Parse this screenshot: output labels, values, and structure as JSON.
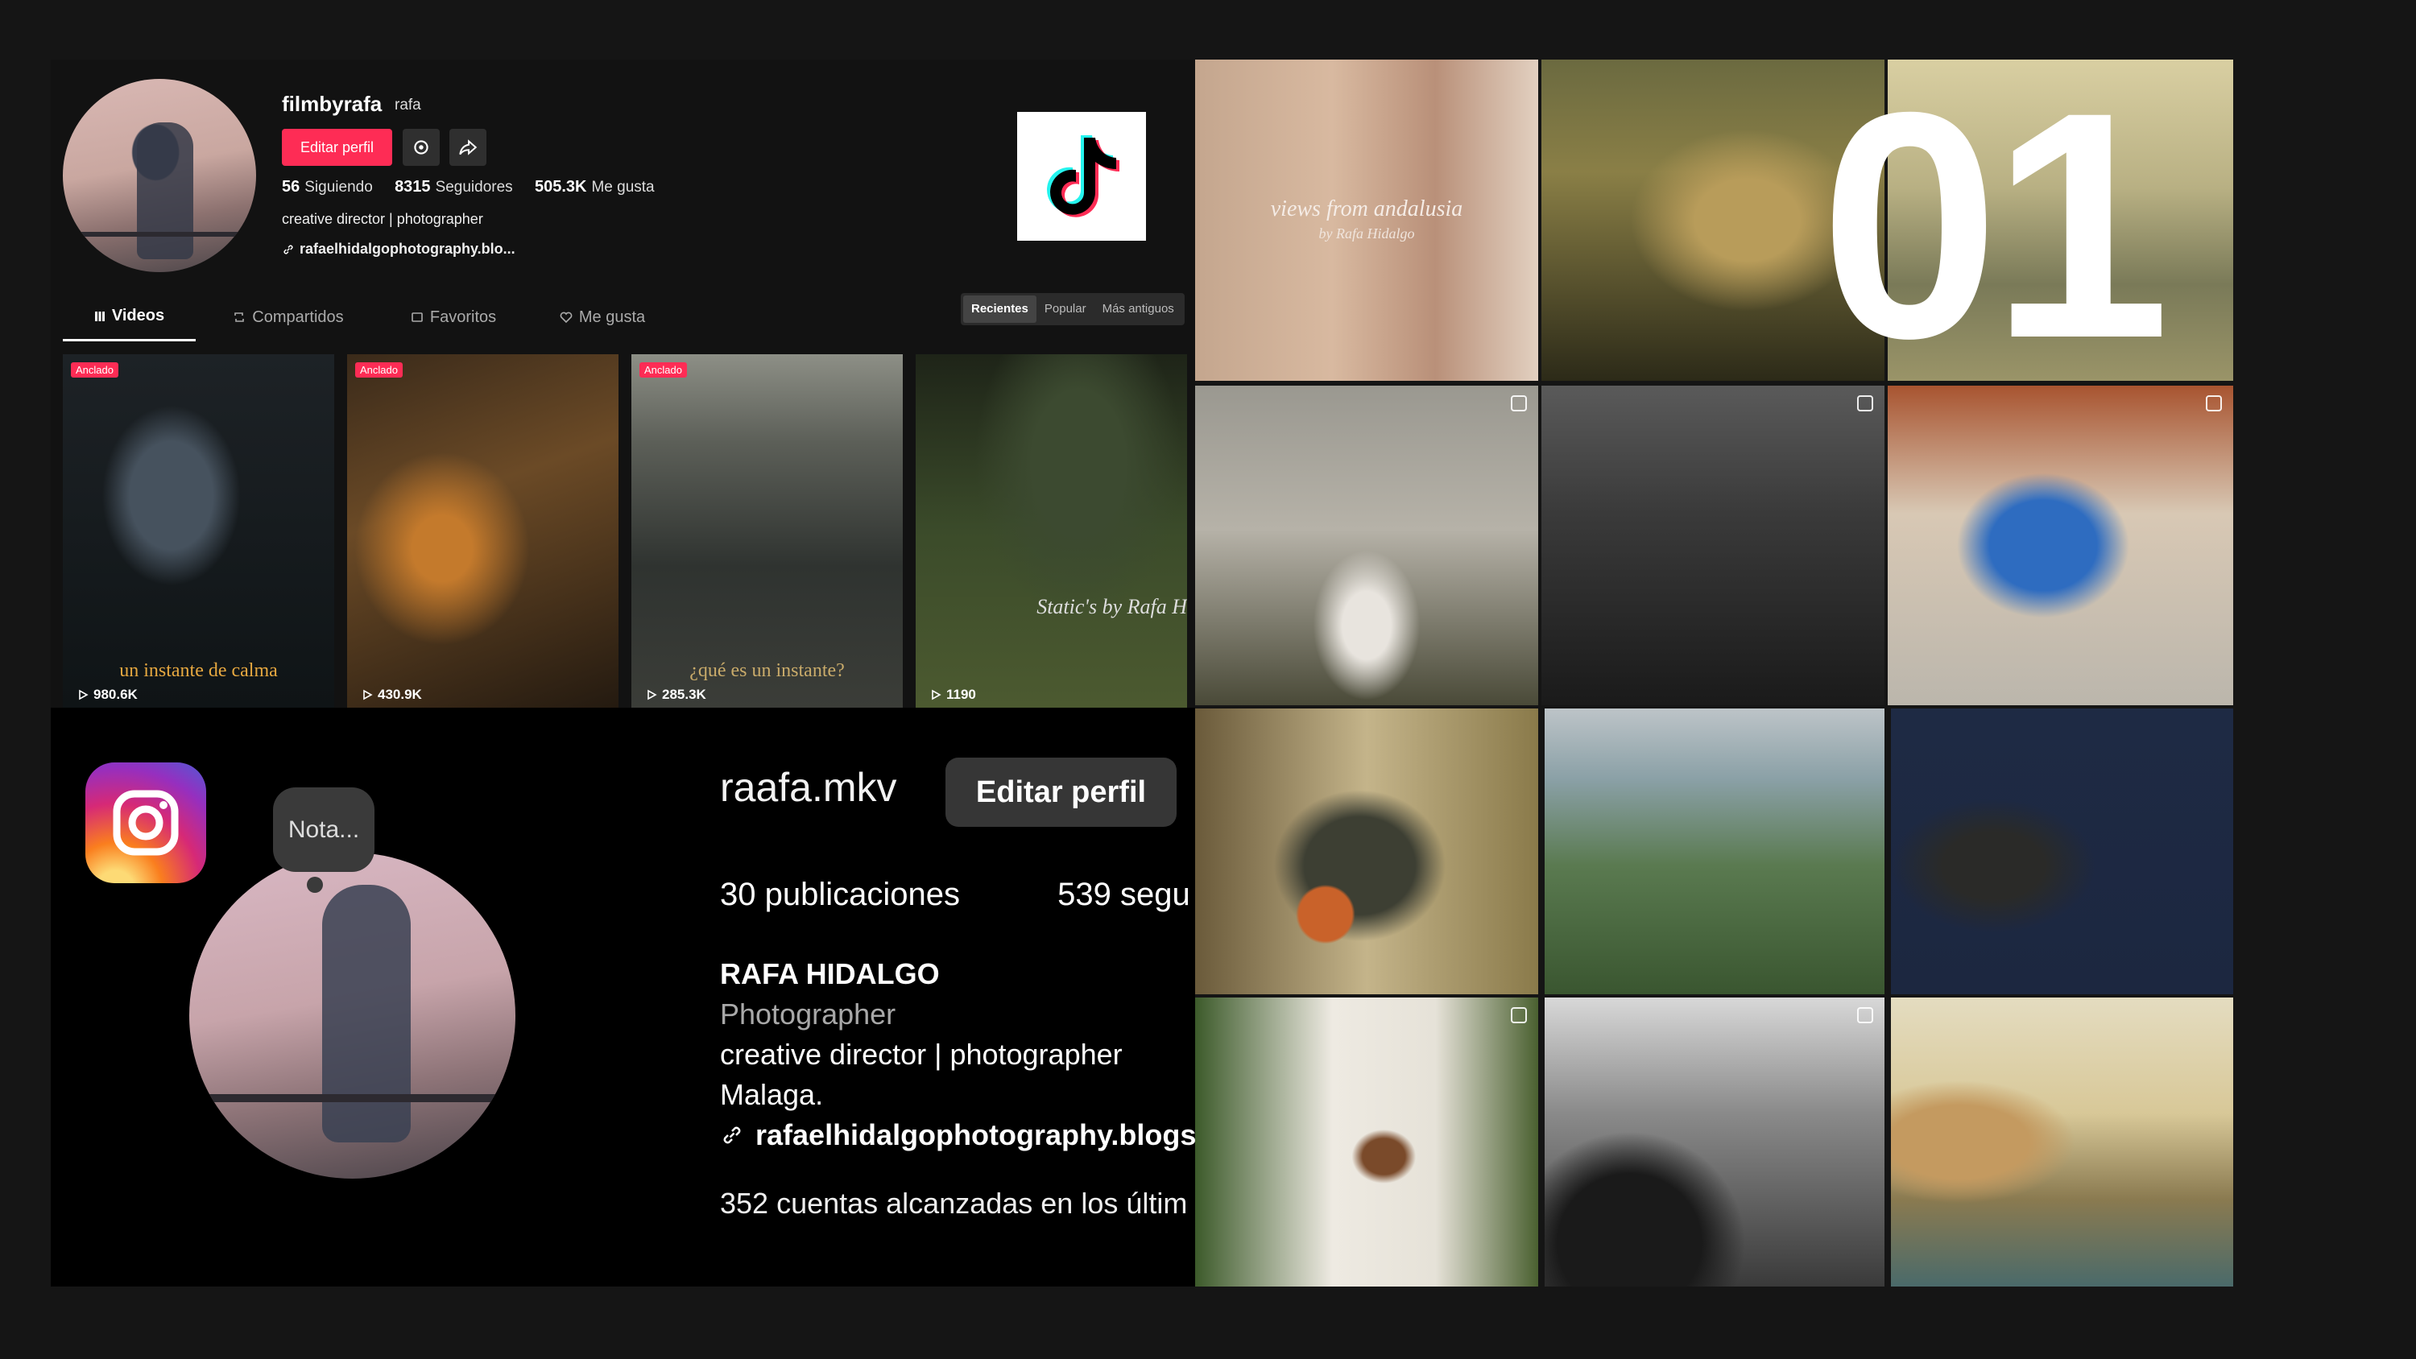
{
  "tiktok": {
    "username": "filmbyrafa",
    "nickname": "rafa",
    "edit_label": "Editar perfil",
    "stats": {
      "following_count": "56",
      "following_label": "Siguiendo",
      "followers_count": "8315",
      "followers_label": "Seguidores",
      "likes_count": "505.3K",
      "likes_label": "Me gusta"
    },
    "bio": "creative director | photographer",
    "link": "rafaelhidalgophotography.blo...",
    "tabs": [
      "Videos",
      "Compartidos",
      "Favoritos",
      "Me gusta"
    ],
    "sort": [
      "Recientes",
      "Popular",
      "Más antiguos"
    ],
    "pinned_label": "Anclado",
    "videos": [
      {
        "views": "980.6K",
        "caption": "un instante de calma"
      },
      {
        "views": "430.9K",
        "caption": ""
      },
      {
        "views": "285.3K",
        "caption": "¿qué es un instante?"
      },
      {
        "views": "1190",
        "caption": "Static's by Rafa H"
      }
    ]
  },
  "instagram": {
    "note": "Nota...",
    "username": "raafa.mkv",
    "edit_label": "Editar perfil",
    "stats": {
      "posts": "30 publicaciones",
      "followers": "539 segu"
    },
    "name": "RAFA HIDALGO",
    "category": "Photographer",
    "bio_line1": "creative director | photographer",
    "bio_line2": "Malaga.",
    "link": "rafaelhidalgophotography.blogs",
    "reach": "352 cuentas alcanzadas en los últim"
  },
  "grid": {
    "tile1_title": "views from andalusia",
    "tile1_subtitle": "by Rafa Hidalgo"
  },
  "overlay_number": "01",
  "colors": {
    "tiktok_red": "#fe2c55",
    "panel_bg": "#121212",
    "ig_bg": "#000000",
    "page_bg": "#151515"
  }
}
